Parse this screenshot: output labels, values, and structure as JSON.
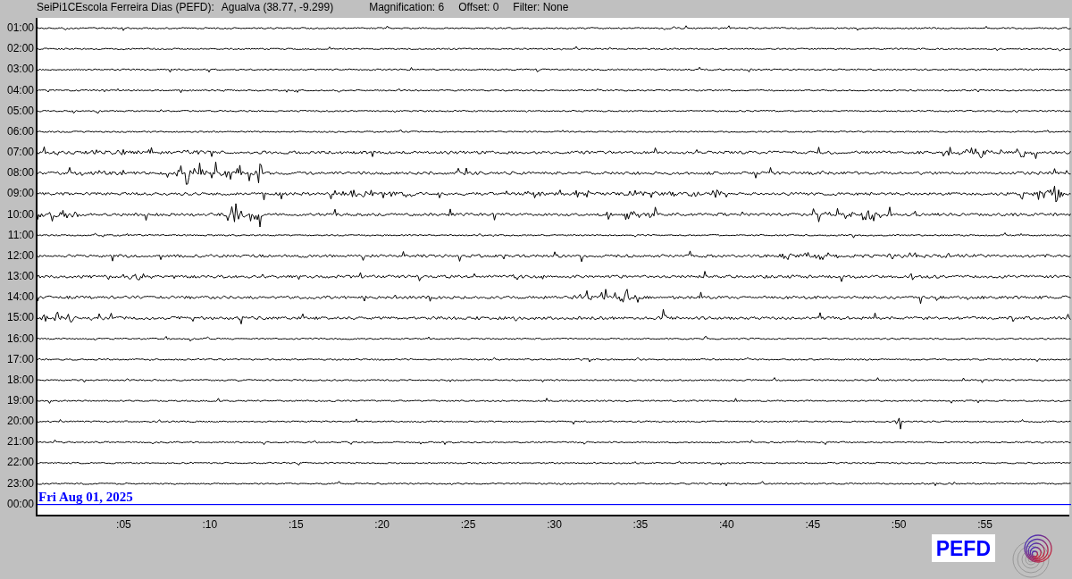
{
  "header": {
    "station": "SeiPi1CEscola Ferreira Dias (PEFD):",
    "location": "Agualva (38.77, -9.299)",
    "magnification": "Magnification: 6",
    "offset": "Offset: 0",
    "filter": "Filter: None"
  },
  "rows": [
    {
      "time": "01:00"
    },
    {
      "time": "02:00"
    },
    {
      "time": "03:00"
    },
    {
      "time": "04:00"
    },
    {
      "time": "05:00"
    },
    {
      "time": "06:00"
    },
    {
      "time": "07:00"
    },
    {
      "time": "08:00"
    },
    {
      "time": "09:00"
    },
    {
      "time": "10:00"
    },
    {
      "time": "11:00"
    },
    {
      "time": "12:00"
    },
    {
      "time": "13:00"
    },
    {
      "time": "14:00"
    },
    {
      "time": "15:00"
    },
    {
      "time": "16:00"
    },
    {
      "time": "17:00"
    },
    {
      "time": "18:00"
    },
    {
      "time": "19:00"
    },
    {
      "time": "20:00"
    },
    {
      "time": "21:00"
    },
    {
      "time": "22:00"
    },
    {
      "time": "23:00"
    },
    {
      "time": "00:00",
      "current": true
    }
  ],
  "date_label": "Fri Aug 01, 2025",
  "x_ticks": [
    ":05",
    ":10",
    ":15",
    ":20",
    ":25",
    ":30",
    ":35",
    ":40",
    ":45",
    ":50",
    ":55"
  ],
  "logo_text": "PEFD"
}
